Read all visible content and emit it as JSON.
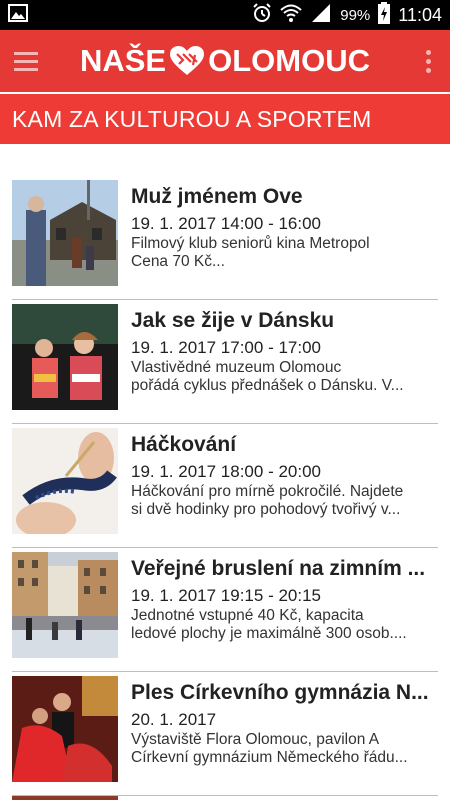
{
  "status_bar": {
    "battery": "99%",
    "time": "11:04",
    "icons": [
      "image-icon",
      "alarm-icon",
      "wifi-icon",
      "signal-icon",
      "battery-charging-icon"
    ]
  },
  "app_bar": {
    "logo_left": "NAŠE",
    "logo_right": "OLOMOUC",
    "logo_icon": "heart-icon",
    "menu_icon": "hamburger-icon",
    "overflow_icon": "more-vert-icon"
  },
  "section": {
    "title": "KAM ZA KULTUROU A SPORTEM"
  },
  "events": [
    {
      "title": "Muž jménem Ove",
      "date": "19. 1. 2017 14:00 - 16:00",
      "desc_line1": "Filmový klub seniorů kina Metropol",
      "desc_line2": "Cena 70 Kč..."
    },
    {
      "title": "Jak se žije v Dánsku",
      "date": "19. 1. 2017 17:00 - 17:00",
      "desc_line1": "Vlastivědné muzeum Olomouc",
      "desc_line2": "pořádá cyklus přednášek o Dánsku. V..."
    },
    {
      "title": "Háčkování",
      "date": "19. 1. 2017 18:00 - 20:00",
      "desc_line1": "Háčkování pro mírně pokročilé. Najdete",
      "desc_line2": "si dvě hodinky pro pohodový tvořivý v..."
    },
    {
      "title": "Veřejné bruslení na zimním ...",
      "date": "19. 1. 2017 19:15 - 20:15",
      "desc_line1": "Jednotné vstupné 40 Kč, kapacita",
      "desc_line2": "ledové plochy je maximálně 300 osob...."
    },
    {
      "title": "Ples Církevního gymnázia N...",
      "date": "20. 1. 2017",
      "desc_line1": "Výstaviště Flora Olomouc, pavilon A",
      "desc_line2": "Církevní gymnázium Německého řádu..."
    }
  ],
  "colors": {
    "app_bar": "#e53935",
    "section_header": "#ef3b35",
    "status_bar": "#000000"
  }
}
